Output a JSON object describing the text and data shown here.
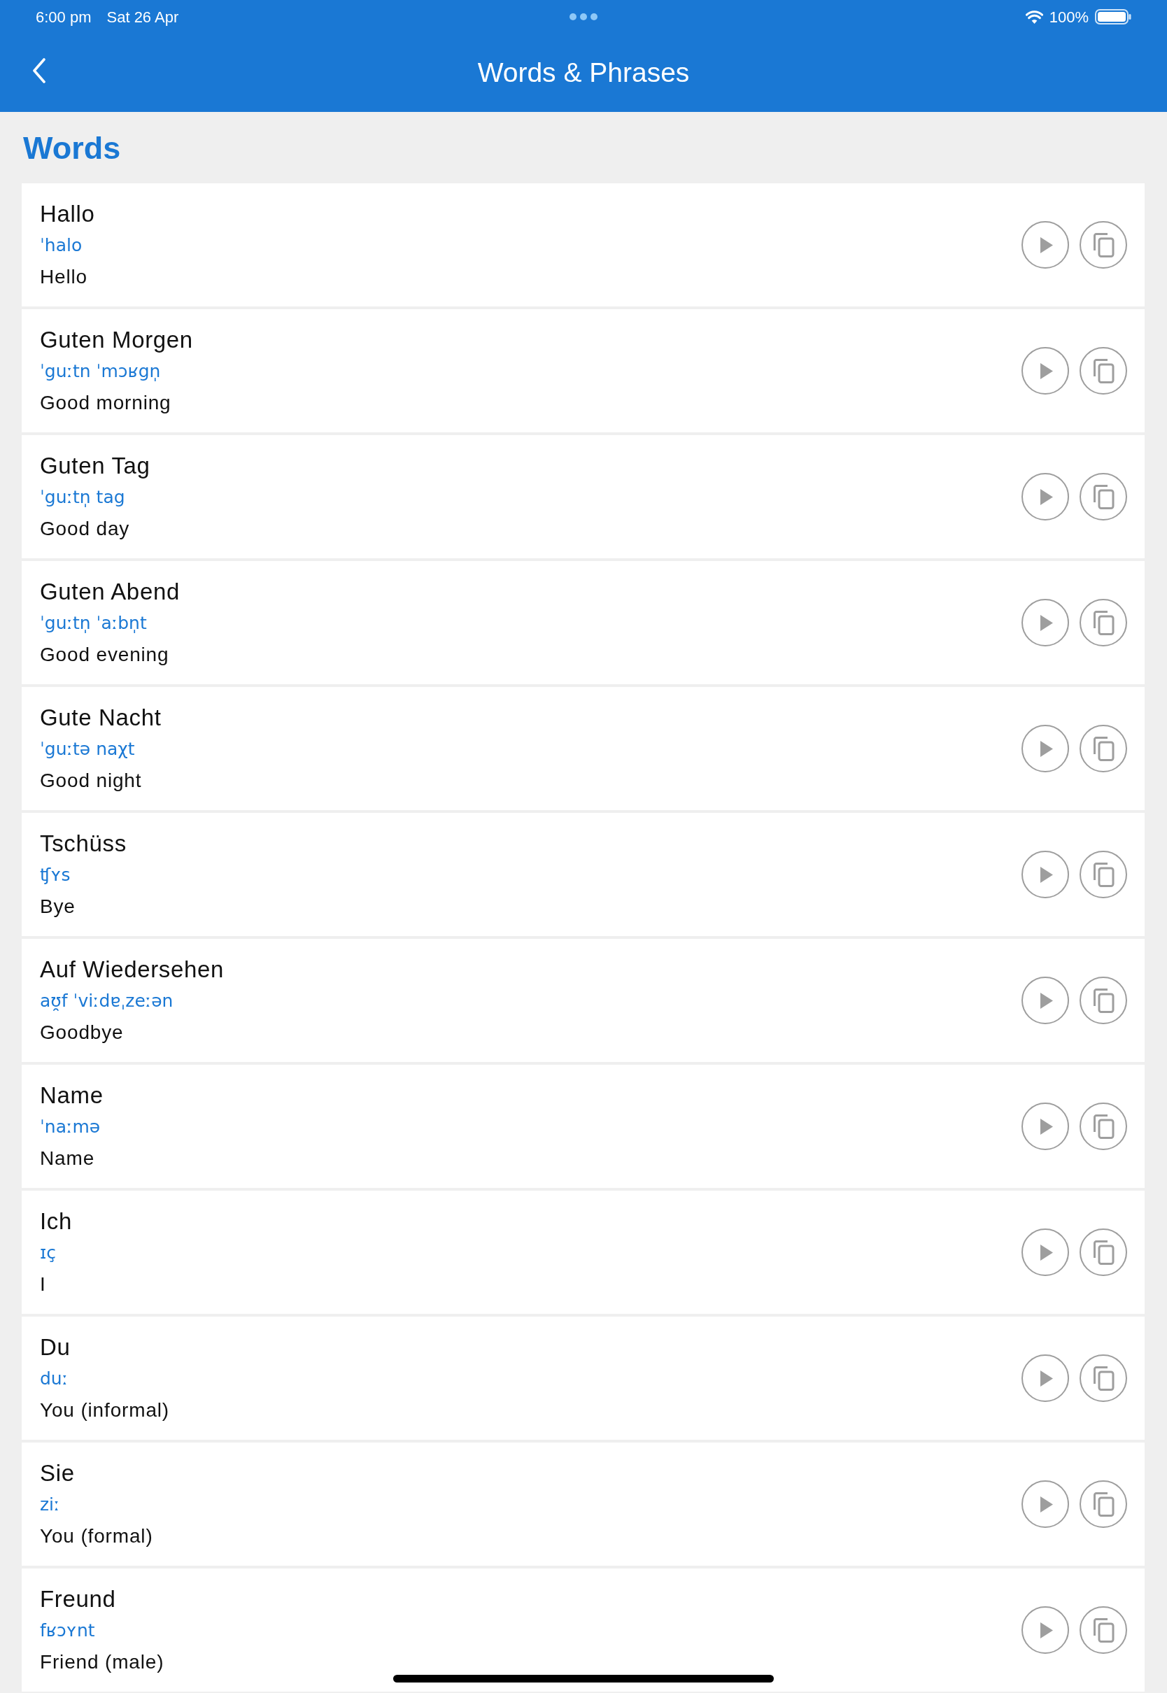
{
  "status_bar": {
    "time": "6:00 pm",
    "date": "Sat 26 Apr",
    "battery": "100%"
  },
  "nav_bar": {
    "title": "Words & Phrases"
  },
  "section": {
    "title": "Words"
  },
  "words": [
    {
      "word": "Hallo",
      "phonetic": "ˈhalo",
      "translation": "Hello"
    },
    {
      "word": "Guten Morgen",
      "phonetic": "ˈguːtn ˈmɔʁgn̩",
      "translation": "Good morning"
    },
    {
      "word": "Guten Tag",
      "phonetic": "ˈguːtn̩ tag",
      "translation": "Good day"
    },
    {
      "word": "Guten Abend",
      "phonetic": "ˈguːtn̩ ˈaːbn̩t",
      "translation": "Good evening"
    },
    {
      "word": "Gute Nacht",
      "phonetic": "ˈguːtə naχt",
      "translation": "Good night"
    },
    {
      "word": "Tschüss",
      "phonetic": "ʧʏs",
      "translation": "Bye"
    },
    {
      "word": "Auf Wiedersehen",
      "phonetic": "aʊ̯f ˈviːdɐˌzeːən",
      "translation": "Goodbye"
    },
    {
      "word": "Name",
      "phonetic": "ˈnaːmə",
      "translation": "Name"
    },
    {
      "word": "Ich",
      "phonetic": "ɪç",
      "translation": "I"
    },
    {
      "word": "Du",
      "phonetic": "duː",
      "translation": "You (informal)"
    },
    {
      "word": "Sie",
      "phonetic": "ziː",
      "translation": "You (formal)"
    },
    {
      "word": "Freund",
      "phonetic": "fʁɔʏnt",
      "translation": "Friend (male)"
    }
  ]
}
